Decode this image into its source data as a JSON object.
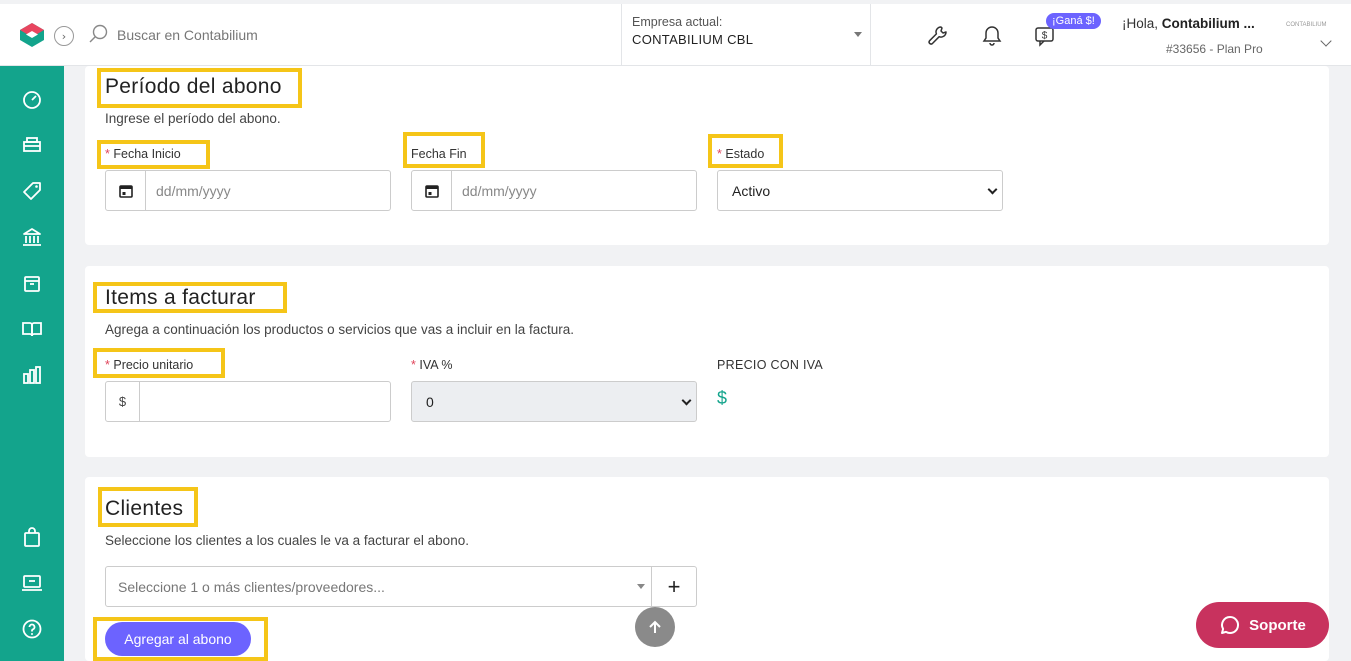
{
  "header": {
    "search_placeholder": "Buscar en Contabilium",
    "company_label": "Empresa actual:",
    "company_value": "CONTABILIUM CBL",
    "promo_badge": "¡Ganá $!",
    "greeting_prefix": "¡Hola,",
    "greeting_name": "Contabilium ...",
    "plan": "#33656 - Plan Pro",
    "mini_logo_text": "CONTABILIUM"
  },
  "sidebar": {
    "icons": [
      "dashboard-icon",
      "sales-icon",
      "tag-icon",
      "bank-icon",
      "inventory-icon",
      "book-icon",
      "reports-icon",
      "shopping-bag-icon",
      "pos-icon",
      "help-icon"
    ]
  },
  "periodo": {
    "title": "Período del abono",
    "subtitle": "Ingrese el período del abono.",
    "fecha_inicio_label": "Fecha Inicio",
    "fecha_inicio_placeholder": "dd/mm/yyyy",
    "fecha_fin_label": "Fecha Fin",
    "fecha_fin_placeholder": "dd/mm/yyyy",
    "estado_label": "Estado",
    "estado_value": "Activo",
    "required_mark": "*"
  },
  "items": {
    "title": "Items a facturar",
    "subtitle": "Agrega a continuación los productos o servicios que vas a incluir en la factura.",
    "precio_label": "Precio unitario",
    "currency_symbol": "$",
    "iva_label": "IVA %",
    "iva_value": "0",
    "precio_iva_label": "PRECIO CON IVA",
    "precio_iva_value": "$",
    "required_mark": "*"
  },
  "clientes": {
    "title": "Clientes",
    "subtitle": "Seleccione los clientes a los cuales le va a facturar el abono.",
    "select_placeholder": "Seleccione 1 o más clientes/proveedores...",
    "add_label": "+",
    "submit_label": "Agregar al abono"
  },
  "support": {
    "label": "Soporte"
  },
  "colors": {
    "accent": "#13a48c",
    "primary": "#6c63ff",
    "highlight": "#f5c518",
    "support": "#c8325e",
    "required": "#e0445a"
  }
}
